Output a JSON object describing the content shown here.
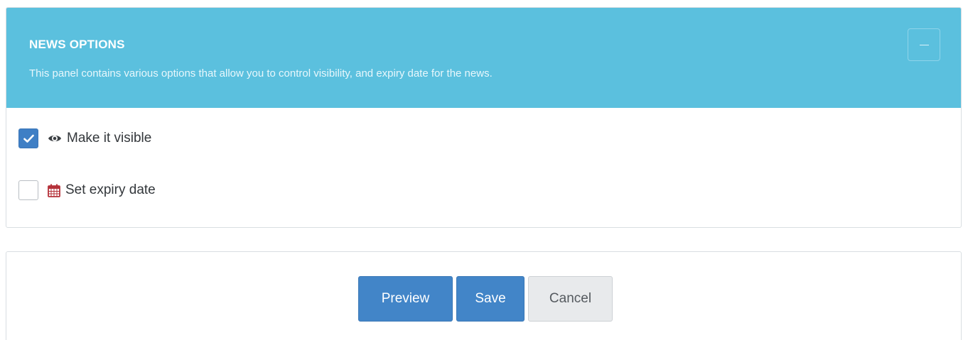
{
  "options_panel": {
    "title": "NEWS OPTIONS",
    "description": "This panel contains various options that allow you to control visibility, and expiry date for the news.",
    "collapse_icon": "minus-icon",
    "options": [
      {
        "label": "Make it visible",
        "checked": true,
        "icon": "eye-icon"
      },
      {
        "label": "Set expiry date",
        "checked": false,
        "icon": "calendar-icon"
      }
    ]
  },
  "actions": {
    "preview_label": "Preview",
    "save_label": "Save",
    "cancel_label": "Cancel"
  },
  "colors": {
    "header_bg": "#5bc0de",
    "primary": "#4285c8",
    "checkbox_checked": "#3f7fc5",
    "calendar_icon": "#b5323a",
    "cancel_bg": "#e8eaec"
  }
}
